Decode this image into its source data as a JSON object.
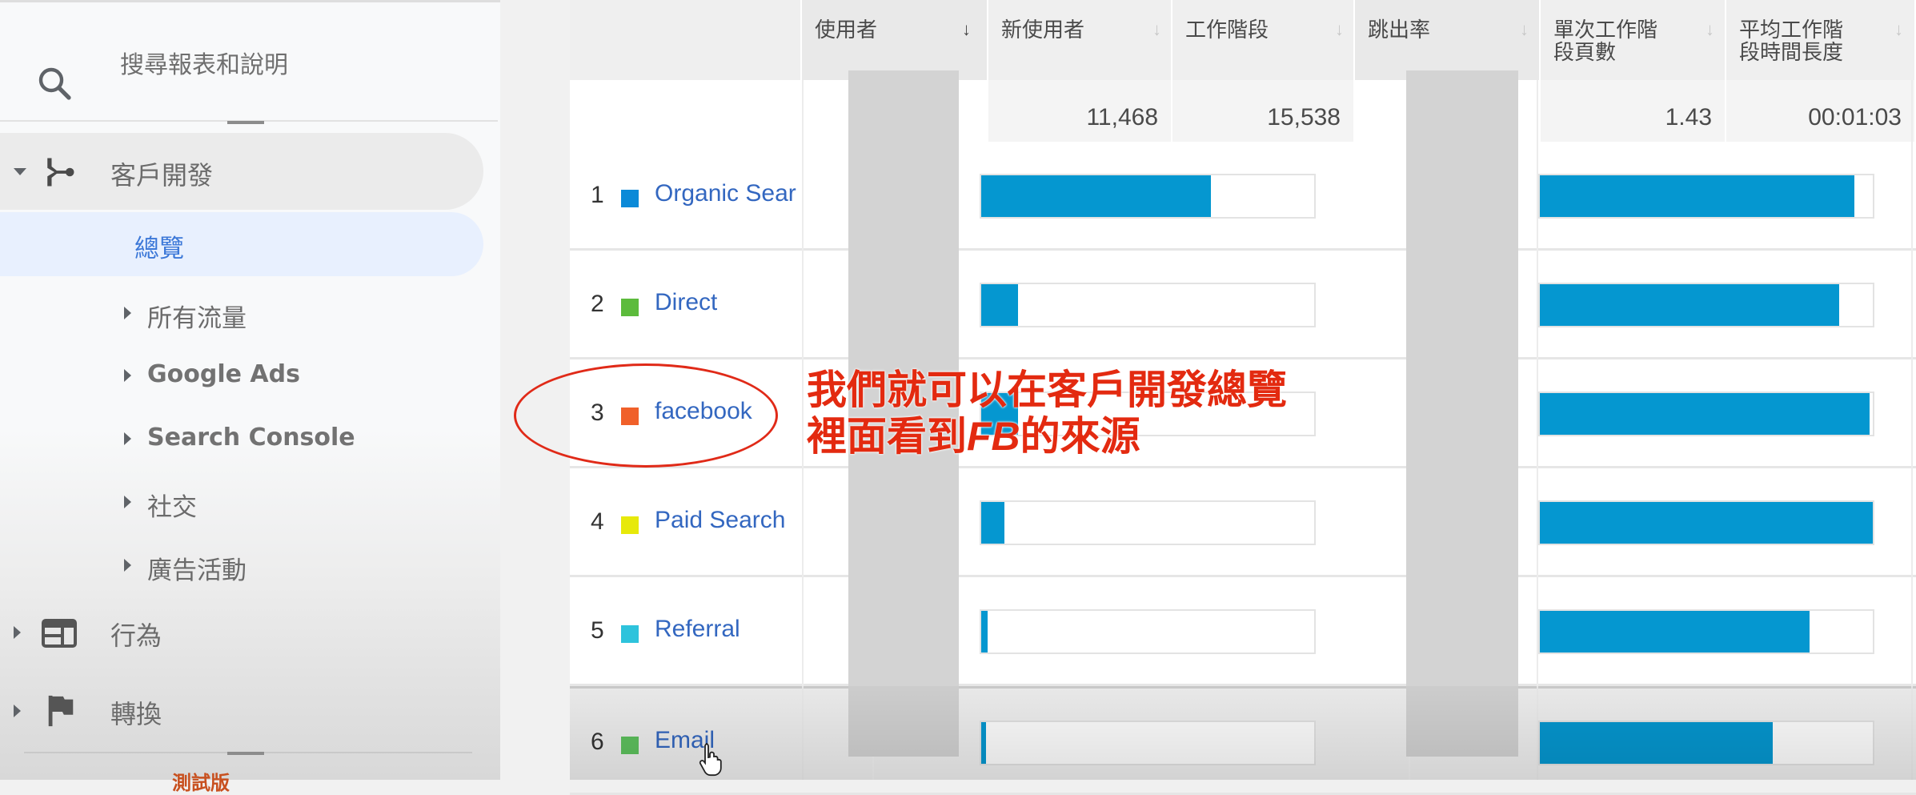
{
  "sidebar": {
    "search_placeholder": "搜尋報表和說明",
    "section": {
      "label": "客戶開發",
      "expanded": true
    },
    "active_item": "總覽",
    "sub_items": [
      {
        "label": "所有流量"
      },
      {
        "label": "Google Ads"
      },
      {
        "label": "Search Console"
      },
      {
        "label": "社交"
      },
      {
        "label": "廣告活動"
      }
    ],
    "other_sections": [
      {
        "label": "行為",
        "icon": "layout-icon"
      },
      {
        "label": "轉換",
        "icon": "flag-icon"
      }
    ],
    "beta_label": "測試版"
  },
  "table": {
    "columns": [
      {
        "label": "使用者",
        "sorted": true
      },
      {
        "label": "新使用者",
        "sorted": false
      },
      {
        "label": "工作階段",
        "sorted": false
      },
      {
        "label": "跳出率",
        "sorted": false
      },
      {
        "label": "單次工作階段頁數",
        "sorted": false
      },
      {
        "label": "平均工作階段時間長度",
        "sorted": false
      }
    ],
    "header_lines": {
      "pages_per_session": [
        "單次工作階",
        "段頁數"
      ],
      "avg_duration": [
        "平均工作階",
        "段時間長度"
      ]
    },
    "sort_icon": "↓",
    "totals": {
      "users": "",
      "new_users": "11,468",
      "sessions": "15,538",
      "bounce_rate": "",
      "pages_per_session": "1.43",
      "avg_session_duration": "00:01:03"
    },
    "rows": [
      {
        "rank": "1",
        "channel": "Organic Sear",
        "color": "#0b8ad8",
        "new_users_share": 0.69,
        "pages_share": 0.945
      },
      {
        "rank": "2",
        "channel": "Direct",
        "color": "#5cbb3c",
        "new_users_share": 0.11,
        "pages_share": 0.9
      },
      {
        "rank": "3",
        "channel": "facebook",
        "color": "#f0602a",
        "new_users_share": 0.11,
        "pages_share": 0.99
      },
      {
        "rank": "4",
        "channel": "Paid Search",
        "color": "#e7e90a",
        "new_users_share": 0.07,
        "pages_share": 1.0
      },
      {
        "rank": "5",
        "channel": "Referral",
        "color": "#2ec3dc",
        "new_users_share": 0.02,
        "pages_share": 0.81
      },
      {
        "rank": "6",
        "channel": "Email",
        "color": "#5ec25e",
        "new_users_share": 0.01,
        "pages_share": 0.7
      }
    ]
  },
  "annotation": {
    "line1": "我們就可以在客戶開發總覽",
    "line2_pre": "裡面看到",
    "line2_em": "FB",
    "line2_post": "的來源",
    "color": "#e32a10"
  },
  "colors": {
    "bar": "#0597d0",
    "link": "#3367c0",
    "active_nav": "#3c78d8"
  }
}
